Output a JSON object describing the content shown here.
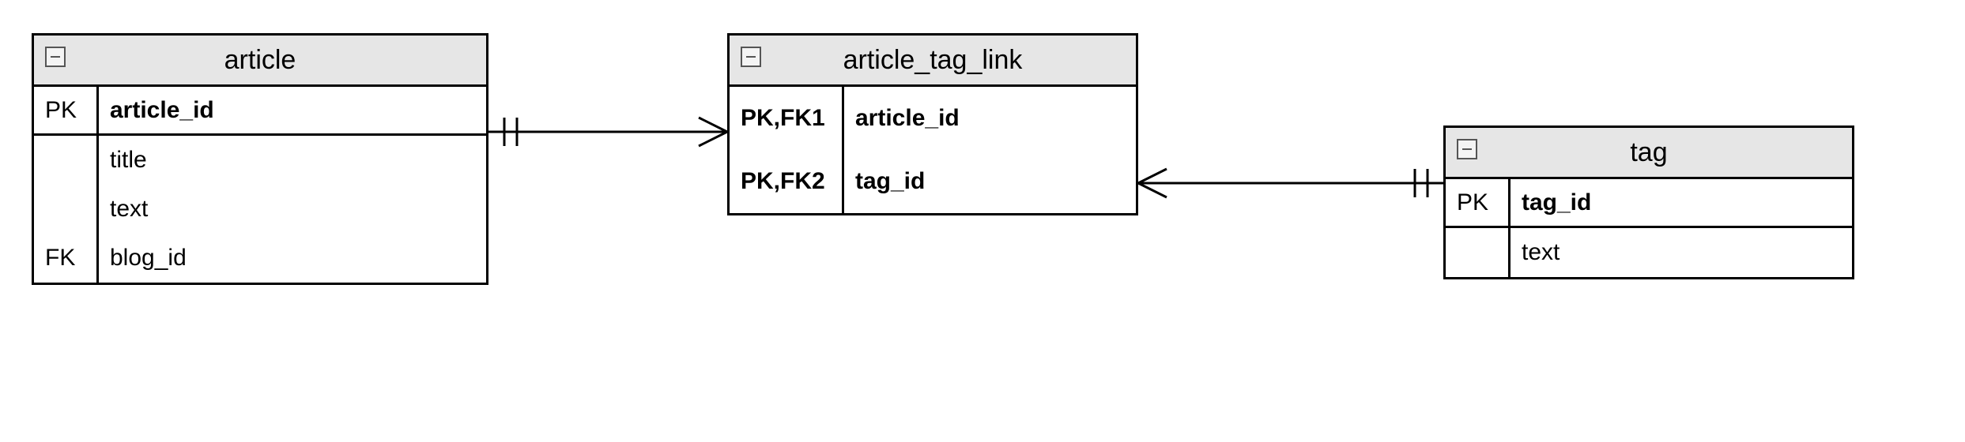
{
  "diagram_type": "entity-relationship",
  "entities": [
    {
      "name": "article",
      "rows": [
        {
          "key": "PK",
          "name": "article_id",
          "is_pk": true
        },
        {
          "key": "",
          "name": "title"
        },
        {
          "key": "",
          "name": "text"
        },
        {
          "key": "FK",
          "name": "blog_id"
        }
      ]
    },
    {
      "name": "article_tag_link",
      "rows": [
        {
          "key": "PK,FK1",
          "name": "article_id",
          "is_pk": true
        },
        {
          "key": "PK,FK2",
          "name": "tag_id",
          "is_pk": true
        }
      ]
    },
    {
      "name": "tag",
      "rows": [
        {
          "key": "PK",
          "name": "tag_id",
          "is_pk": true
        },
        {
          "key": "",
          "name": "text"
        }
      ]
    }
  ],
  "relationships": [
    {
      "from": "article",
      "to": "article_tag_link",
      "cardinality": "one-to-many"
    },
    {
      "from": "article_tag_link",
      "to": "tag",
      "cardinality": "many-to-one"
    }
  ]
}
